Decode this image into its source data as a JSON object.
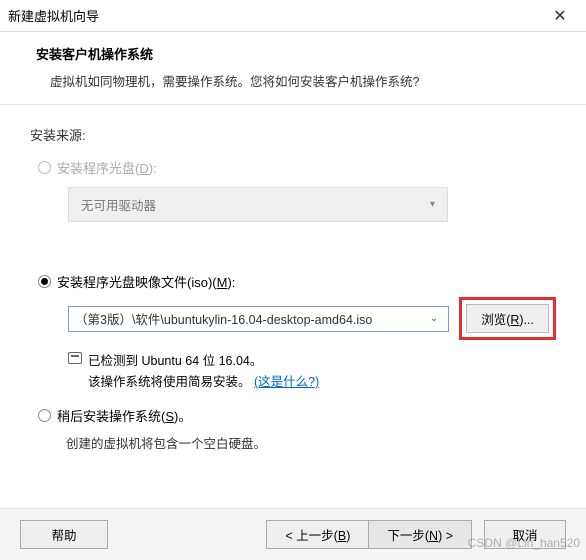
{
  "window": {
    "title": "新建虚拟机向导",
    "close": "✕"
  },
  "header": {
    "title": "安装客户机操作系统",
    "subtitle": "虚拟机如同物理机，需要操作系统。您将如何安装客户机操作系统?"
  },
  "content": {
    "source_label": "安装来源:",
    "disc": {
      "label_pre": "安装程序光盘(",
      "label_u": "D",
      "label_post": "):",
      "dropdown": "无可用驱动器"
    },
    "iso": {
      "label_pre": "安装程序光盘映像文件(iso)(",
      "label_u": "M",
      "label_post": "):",
      "path": "（第3版）\\软件\\ubuntukylin-16.04-desktop-amd64.iso",
      "browse_pre": "浏览(",
      "browse_u": "R",
      "browse_post": ")...",
      "detected": "已检测到 Ubuntu 64 位 16.04。",
      "easy_install": "该操作系统将使用简易安装。",
      "whats_this": "(这是什么?)"
    },
    "later": {
      "label_pre": "稍后安装操作系统(",
      "label_u": "S",
      "label_post": ")。",
      "note": "创建的虚拟机将包含一个空白硬盘。"
    }
  },
  "footer": {
    "help": "帮助",
    "back_pre": "< 上一步(",
    "back_u": "B",
    "back_post": ")",
    "next_pre": "下一步(",
    "next_u": "N",
    "next_post": ") >",
    "cancel": "取消"
  },
  "watermark": "CSDN @Lin_han520"
}
